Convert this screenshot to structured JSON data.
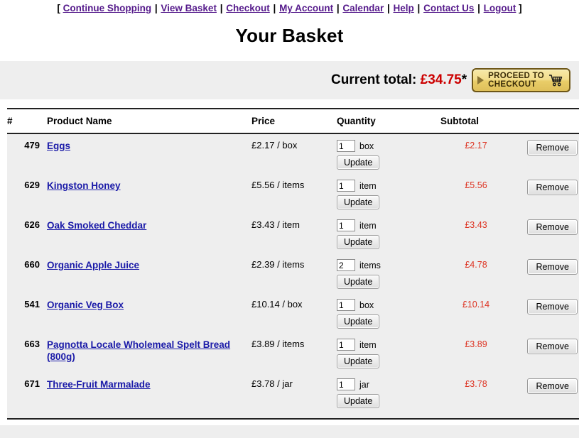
{
  "nav": {
    "open_bracket": "[",
    "close_bracket": "]",
    "separator": "|",
    "items": [
      {
        "label": "Continue Shopping"
      },
      {
        "label": "View Basket"
      },
      {
        "label": "Checkout"
      },
      {
        "label": "My Account"
      },
      {
        "label": "Calendar"
      },
      {
        "label": "Help"
      },
      {
        "label": "Contact Us"
      },
      {
        "label": "Logout"
      }
    ]
  },
  "page": {
    "title": "Your Basket"
  },
  "summary": {
    "total_label": "Current total:",
    "total_amount": "£34.75",
    "asterisk": "*",
    "checkout_button_label": "PROCEED TO\nCHECKOUT",
    "checkout_icon": "shopping-cart-icon",
    "checkout_play_icon": "play-triangle-icon",
    "accent_total_color": "#cc0000",
    "accent_button_color": "#e9cd68"
  },
  "table": {
    "headers": {
      "id": "#",
      "name": "Product Name",
      "price": "Price",
      "quantity": "Quantity",
      "subtotal": "Subtotal",
      "actions": ""
    },
    "update_label": "Update",
    "remove_label": "Remove",
    "rows": [
      {
        "id": "479",
        "name": "Eggs",
        "price": "£2.17 / box",
        "qty": "1",
        "unit": "box",
        "subtotal": "£2.17"
      },
      {
        "id": "629",
        "name": "Kingston Honey",
        "price": "£5.56 / items",
        "qty": "1",
        "unit": "item",
        "subtotal": "£5.56"
      },
      {
        "id": "626",
        "name": "Oak Smoked Cheddar",
        "price": "£3.43 / item",
        "qty": "1",
        "unit": "item",
        "subtotal": "£3.43"
      },
      {
        "id": "660",
        "name": "Organic Apple Juice",
        "price": "£2.39 / items",
        "qty": "2",
        "unit": "items",
        "subtotal": "£4.78"
      },
      {
        "id": "541",
        "name": "Organic Veg Box",
        "price": "£10.14 / box",
        "qty": "1",
        "unit": "box",
        "subtotal": "£10.14"
      },
      {
        "id": "663",
        "name": "Pagnotta Locale Wholemeal Spelt Bread (800g)",
        "price": "£3.89 / items",
        "qty": "1",
        "unit": "item",
        "subtotal": "£3.89"
      },
      {
        "id": "671",
        "name": "Three-Fruit Marmalade",
        "price": "£3.78 / jar",
        "qty": "1",
        "unit": "jar",
        "subtotal": "£3.78"
      }
    ]
  }
}
